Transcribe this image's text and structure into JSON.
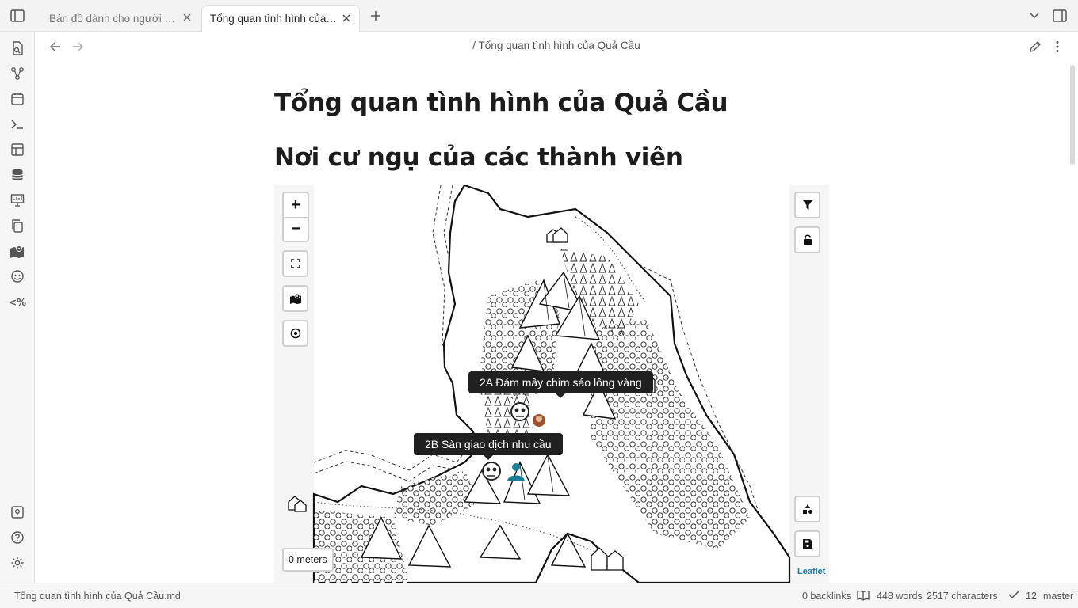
{
  "tabs": [
    {
      "label": "Bản đồ dành cho người mới",
      "active": false
    },
    {
      "label": "Tổng quan tình hình của ...",
      "active": true
    }
  ],
  "breadcrumb": "/ Tổng quan tình hình của Quả Cầu",
  "page": {
    "title": "Tổng quan tình hình của Quả Cầu",
    "section_title": "Nơi cư ngụ của các thành viên"
  },
  "map": {
    "zoom_in": "+",
    "zoom_out": "−",
    "scale": "0 meters",
    "attribution": "Leaflet",
    "tooltips": [
      "2A Đám mây chim sáo lông vàng",
      "2B Sàn giao dịch nhu cầu"
    ]
  },
  "status": {
    "file": "Tổng quan tình hình của Quả Cầu.md",
    "backlinks": "0 backlinks",
    "words": "448 words",
    "characters": "2517 characters",
    "sync_count": "12",
    "branch": "master"
  },
  "colors": {
    "accent": "#1d7ca8",
    "marker_user": "#1b7f99",
    "tooltip_bg": "#202020"
  }
}
